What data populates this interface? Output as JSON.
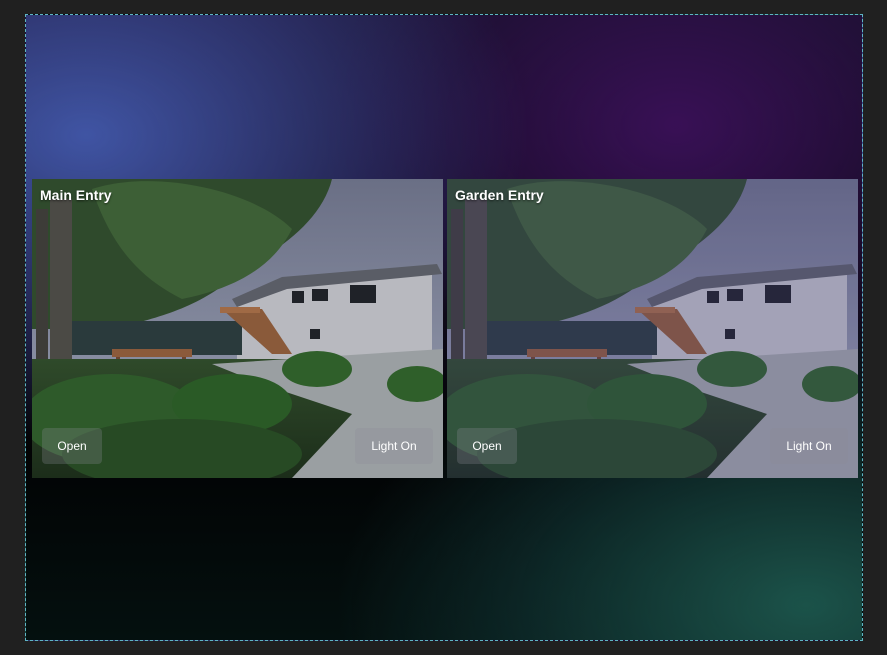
{
  "cameras": [
    {
      "title": "Main Entry",
      "open_label": "Open",
      "light_label": "Light On"
    },
    {
      "title": "Garden Entry",
      "open_label": "Open",
      "light_label": "Light On"
    }
  ],
  "colors": {
    "page_bg": "#202020",
    "frame_border": "#5fb6c4",
    "button_bg": "rgba(140,140,150,0.28)"
  }
}
